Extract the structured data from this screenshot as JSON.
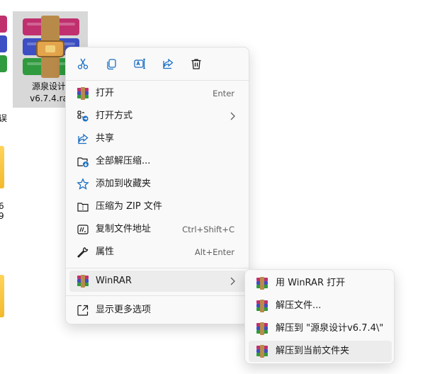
{
  "desktop": {
    "file_name_line1": "源泉设计",
    "file_name_line2": "v6.7.4.ra",
    "edge_char_1": "误",
    "edge_char_2": "6",
    "edge_char_3": "9"
  },
  "toolbar": {
    "cut": "cut-icon",
    "copy": "copy-icon",
    "rename": "rename-icon",
    "share": "share-icon",
    "delete": "delete-icon"
  },
  "menu": {
    "items": [
      {
        "label": "打开",
        "shortcut": "Enter",
        "icon": "winrar-icon"
      },
      {
        "label": "打开方式",
        "shortcut": "",
        "icon": "open-with-icon",
        "submenu": true
      },
      {
        "label": "共享",
        "shortcut": "",
        "icon": "share-icon"
      },
      {
        "label": "全部解压缩...",
        "shortcut": "",
        "icon": "extract-all-icon"
      },
      {
        "label": "添加到收藏夹",
        "shortcut": "",
        "icon": "star-icon"
      },
      {
        "label": "压缩为 ZIP 文件",
        "shortcut": "",
        "icon": "zip-icon"
      },
      {
        "label": "复制文件地址",
        "shortcut": "Ctrl+Shift+C",
        "icon": "copy-path-icon"
      },
      {
        "label": "属性",
        "shortcut": "Alt+Enter",
        "icon": "wrench-icon"
      },
      {
        "label": "WinRAR",
        "shortcut": "",
        "icon": "winrar-icon",
        "submenu": true
      },
      {
        "label": "显示更多选项",
        "shortcut": "",
        "icon": "more-options-icon"
      }
    ]
  },
  "submenu": {
    "items": [
      {
        "label": "用 WinRAR 打开",
        "icon": "winrar-icon"
      },
      {
        "label": "解压文件...",
        "icon": "winrar-icon"
      },
      {
        "label": "解压到 \"源泉设计v6.7.4\\\"",
        "icon": "winrar-icon"
      },
      {
        "label": "解压到当前文件夹",
        "icon": "winrar-icon"
      }
    ]
  },
  "colors": {
    "menu_bg": "#f9f9f9",
    "hover_bg": "#ececec",
    "icon_blue": "#1a6fc4",
    "selected_tile": "#d8d8d8"
  }
}
